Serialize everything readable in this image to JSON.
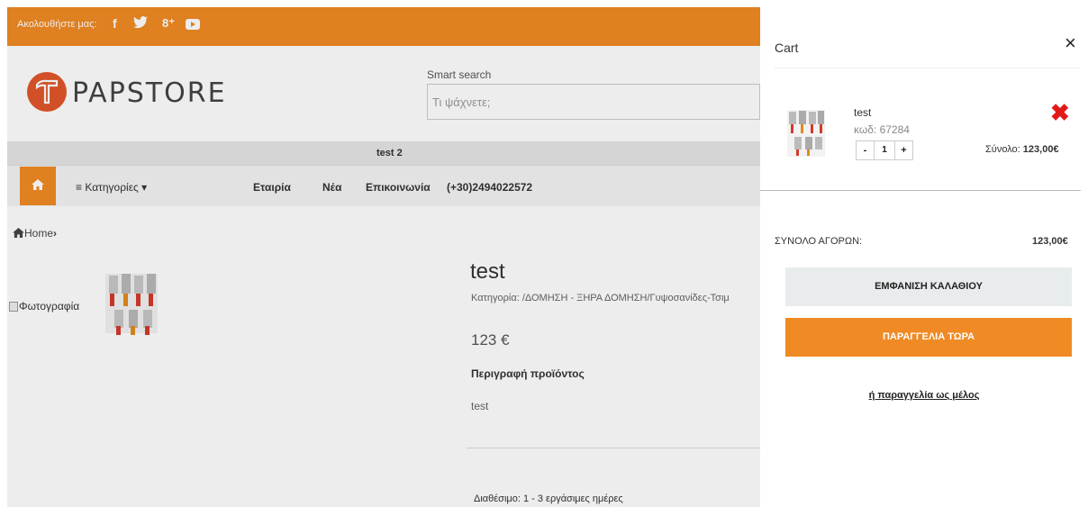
{
  "topbar": {
    "follow_text": "Ακολουθήστε μας:",
    "social_icons": [
      "facebook-icon",
      "twitter-icon",
      "google-plus-icon",
      "youtube-icon"
    ],
    "facebook_glyph": "f",
    "google_glyph": "8⁺"
  },
  "logo": {
    "text": "PAPSTORE"
  },
  "search": {
    "label": "Smart search",
    "placeholder": "Τι ψάχνετε;"
  },
  "promo": {
    "text": "test 2"
  },
  "nav": {
    "categories": "≡ Κατηγορίες ▾",
    "items": [
      "Εταιρία",
      "Νέα",
      "Επικοινωνία",
      "(+30)2494022572"
    ]
  },
  "breadcrumb": {
    "home": "Home",
    "sep": "›"
  },
  "product": {
    "photo_alt": "Φωτογραφία",
    "title": "test",
    "category": "Κατηγορία: /ΔΟΜΗΣΗ - ΞΗΡΑ ΔΟΜΗΣΗ/Γυψοσανίδες-Τσιμ",
    "price": "123 €",
    "desc_heading": "Περιγραφή προϊόντος",
    "desc": "test",
    "availability": "Διαθέσιμο: 1 - 3 εργάσιμες ημέρες"
  },
  "cart": {
    "title": "Cart",
    "close": "×",
    "item": {
      "name": "test",
      "code": "κωδ: 67284",
      "qty": "1",
      "minus": "-",
      "plus": "+",
      "remove": "✖",
      "subtotal_label": "Σύνολο:",
      "subtotal_value": "123,00€"
    },
    "total_label": "ΣΥΝΟΛΟ ΑΓΟΡΩΝ:",
    "total_value": "123,00€",
    "view_button": "ΕΜΦΑΝΙΣΗ ΚΑΛΑΘΙΟΥ",
    "order_button": "ΠΑΡΑΓΓΕΛΙΑ ΤΩΡΑ",
    "member_link": "ή παραγγελία ως μέλος"
  },
  "colors": {
    "accent": "#f08a24",
    "logo": "#e2572a",
    "remove": "#e01919"
  }
}
